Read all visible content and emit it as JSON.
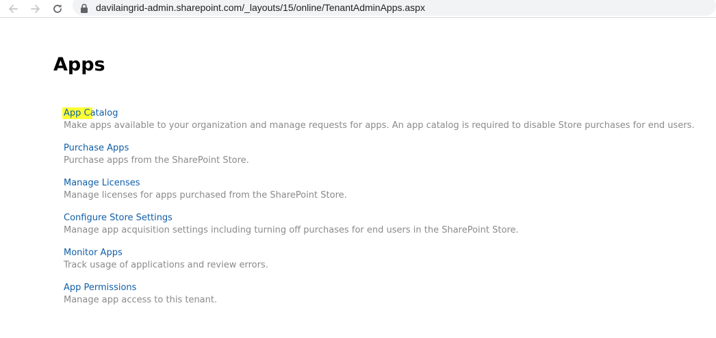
{
  "browser": {
    "url": "davilaingrid-admin.sharepoint.com/_layouts/15/online/TenantAdminApps.aspx",
    "back_icon": "back-arrow-icon",
    "forward_icon": "forward-arrow-icon",
    "reload_icon": "reload-icon",
    "lock_icon": "lock-icon"
  },
  "page": {
    "title": "Apps"
  },
  "apps": [
    {
      "label": "App Catalog",
      "description": "Make apps available to your organization and manage requests for apps. An app catalog is required to disable Store purchases for end users."
    },
    {
      "label": "Purchase Apps",
      "description": "Purchase apps from the SharePoint Store."
    },
    {
      "label": "Manage Licenses",
      "description": "Manage licenses for apps purchased from the SharePoint Store."
    },
    {
      "label": "Configure Store Settings",
      "description": "Manage app acquisition settings including turning off purchases for end users in the SharePoint Store."
    },
    {
      "label": "Monitor Apps",
      "description": "Track usage of applications and review errors."
    },
    {
      "label": "App Permissions",
      "description": "Manage app access to this tenant."
    }
  ],
  "colors": {
    "link": "#0f5ea8",
    "description": "#8a8a8a",
    "highlight": "#ffff33"
  }
}
